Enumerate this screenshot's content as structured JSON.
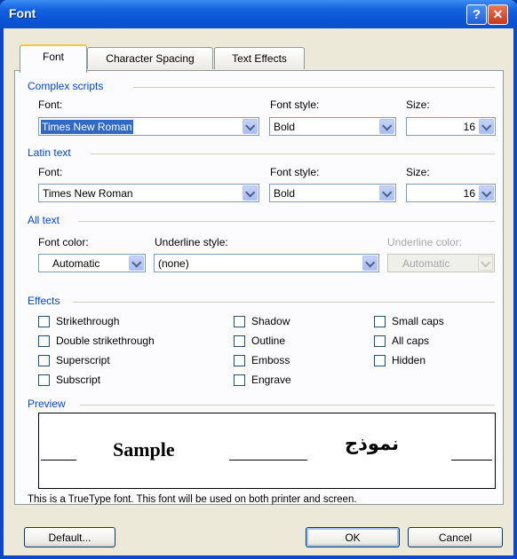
{
  "window": {
    "title": "Font"
  },
  "titlebar": {
    "help_glyph": "?",
    "close_glyph": "✕"
  },
  "tabs": [
    {
      "label": "Font",
      "active": true
    },
    {
      "label": "Character Spacing",
      "active": false
    },
    {
      "label": "Text Effects",
      "active": false
    }
  ],
  "complex_scripts": {
    "group_label": "Complex scripts",
    "font_label": "Font:",
    "font_value": "Times New Roman",
    "style_label": "Font style:",
    "style_value": "Bold",
    "size_label": "Size:",
    "size_value": "16"
  },
  "latin_text": {
    "group_label": "Latin text",
    "font_label": "Font:",
    "font_value": "Times New Roman",
    "style_label": "Font style:",
    "style_value": "Bold",
    "size_label": "Size:",
    "size_value": "16"
  },
  "all_text": {
    "group_label": "All text",
    "color_label": "Font color:",
    "color_value": "Automatic",
    "underline_label": "Underline style:",
    "underline_value": "(none)",
    "underline_color_label": "Underline color:",
    "underline_color_value": "Automatic"
  },
  "effects": {
    "group_label": "Effects",
    "strikethrough": "Strikethrough",
    "double_strikethrough": "Double strikethrough",
    "superscript": "Superscript",
    "subscript": "Subscript",
    "shadow": "Shadow",
    "outline": "Outline",
    "emboss": "Emboss",
    "engrave": "Engrave",
    "small_caps": "Small caps",
    "all_caps": "All caps",
    "hidden": "Hidden"
  },
  "preview": {
    "group_label": "Preview",
    "sample_latin": "Sample",
    "sample_arabic": "نموذج",
    "note": "This is a TrueType font. This font will be used on both printer and screen."
  },
  "buttons": {
    "default": "Default...",
    "ok": "OK",
    "cancel": "Cancel"
  },
  "colors": {
    "group_label": "#0046d5",
    "title_bar": "#0a54d6",
    "selection": "#316ac5"
  }
}
